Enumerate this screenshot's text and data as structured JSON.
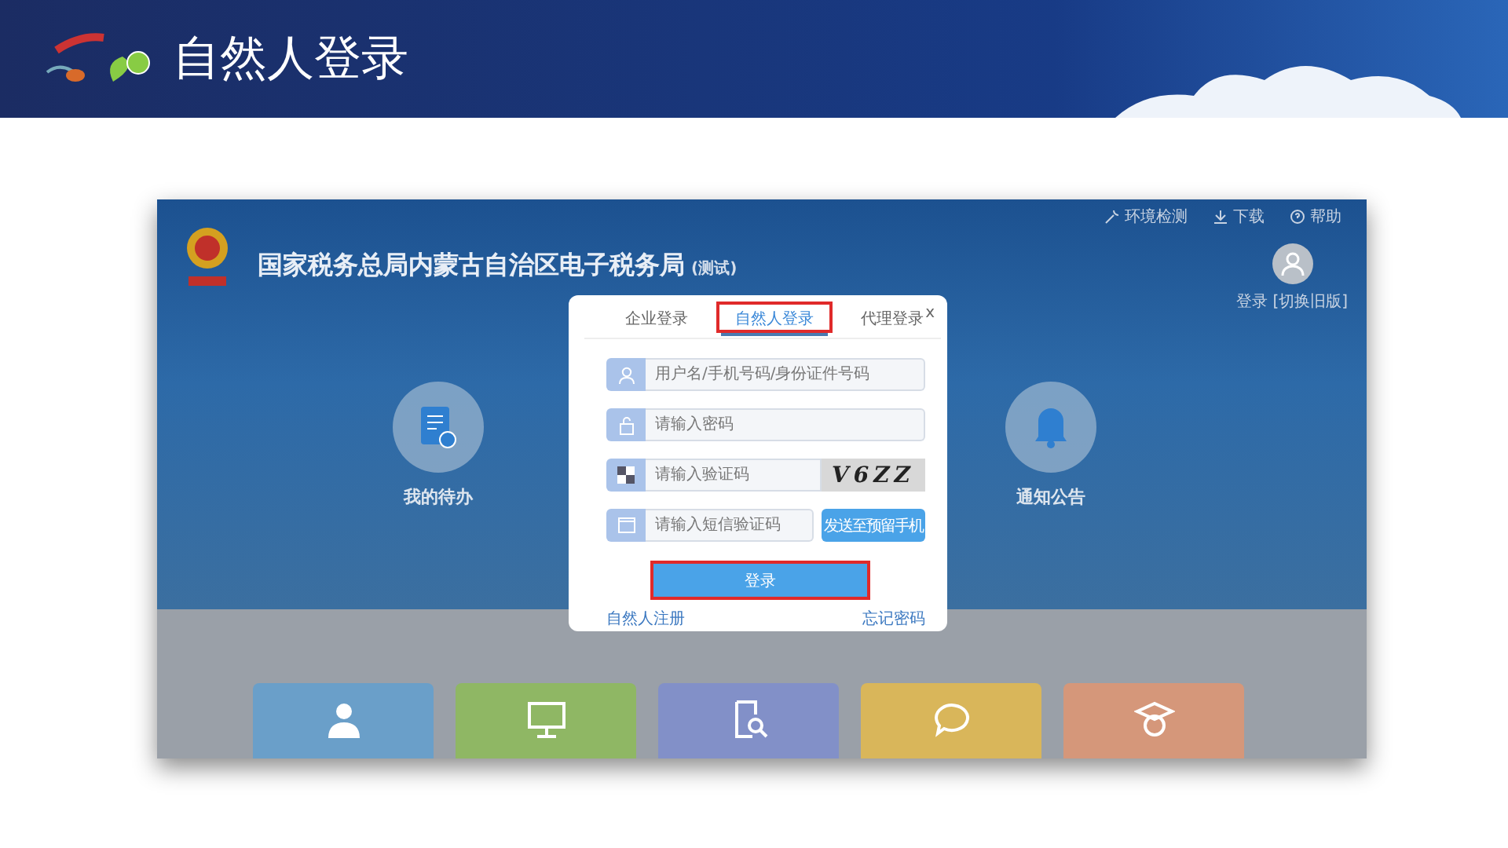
{
  "slide_title": "自然人登录",
  "site": {
    "title": "国家税务总局内蒙古自治区电子税务局",
    "title_note": "(测试)",
    "top_links": [
      {
        "kind": "env",
        "label": "环境检测"
      },
      {
        "kind": "download",
        "label": "下载"
      },
      {
        "kind": "help",
        "label": "帮助"
      }
    ],
    "user": {
      "login": "登录",
      "switch": "[切换旧版]"
    },
    "shortcuts": [
      {
        "kind": "todo",
        "label": "我的待办"
      },
      {
        "kind": "notice",
        "label": "通知公告"
      }
    ],
    "tiles": [
      {
        "kind": "user",
        "color": "#6a9fc9"
      },
      {
        "kind": "monitor",
        "color": "#8fb764"
      },
      {
        "kind": "search",
        "color": "#8290c8"
      },
      {
        "kind": "chat",
        "color": "#d9b65a"
      },
      {
        "kind": "student",
        "color": "#d5977a"
      }
    ]
  },
  "dialog": {
    "close": "x",
    "tabs": [
      {
        "label": "企业登录",
        "selected": false,
        "annotated": false
      },
      {
        "label": "自然人登录",
        "selected": true,
        "annotated": true
      },
      {
        "label": "代理登录",
        "selected": false,
        "annotated": false
      }
    ],
    "fields": [
      {
        "kind": "user",
        "placeholder": "用户名/手机号码/身份证件号码"
      },
      {
        "kind": "lock",
        "placeholder": "请输入密码"
      },
      {
        "kind": "captcha",
        "placeholder": "请输入验证码",
        "captcha": "V6ZZ"
      },
      {
        "kind": "sms",
        "placeholder": "请输入短信验证码",
        "button": "发送至预留手机"
      }
    ],
    "login": {
      "label": "登录",
      "annotated": true
    },
    "register": "自然人注册",
    "forgot": "忘记密码"
  }
}
